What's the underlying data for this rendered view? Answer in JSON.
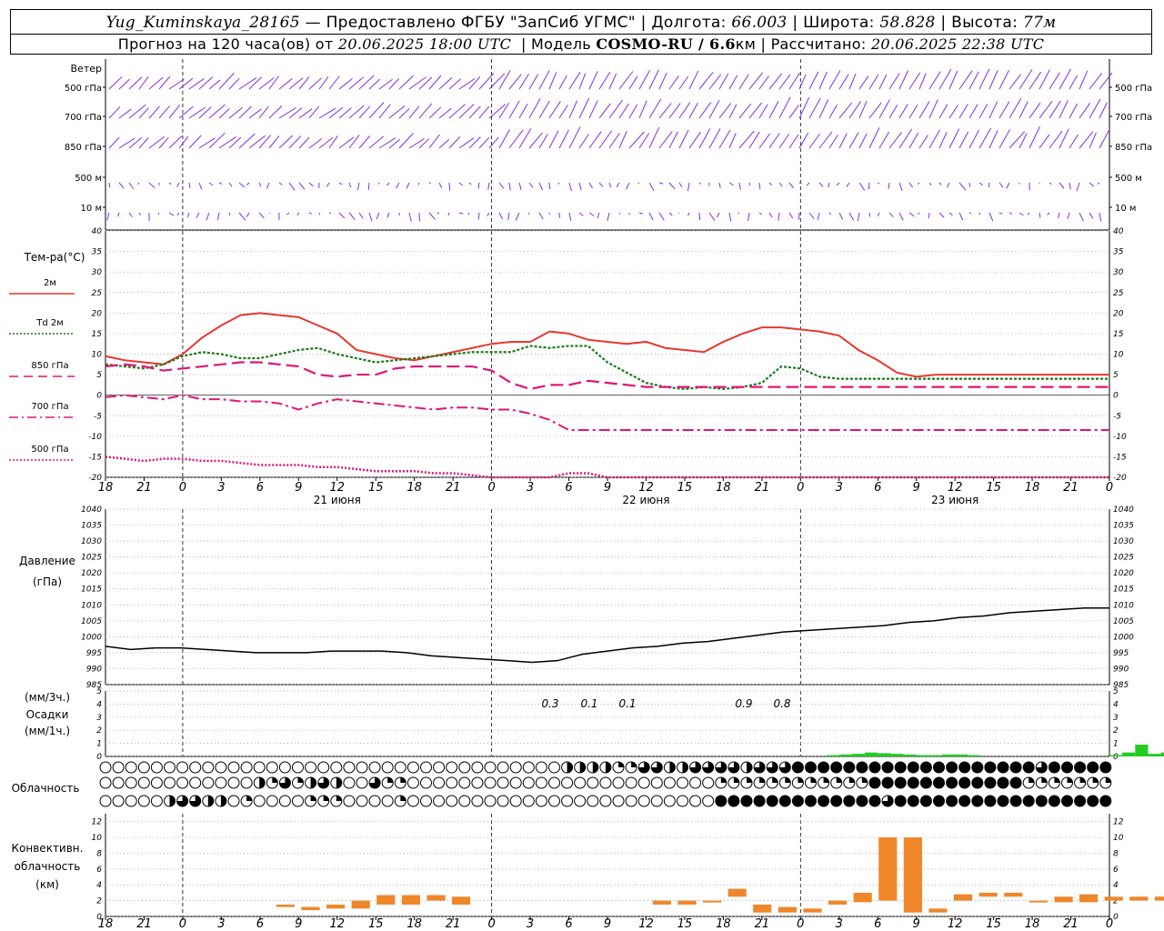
{
  "header": {
    "station": "Yug_Kuminskaya_28165",
    "provider": "— Предоставлено ФГБУ \"ЗапСиб УГМС\"",
    "lon_label": "Долгота:",
    "lon": "66.003",
    "lat_label": "Широта:",
    "lat": "58.828",
    "alt_label": "Высота:",
    "alt": "77м",
    "forecast_prefix": "Прогноз на 120 часа(ов) от",
    "forecast_time": "20.06.2025 18:00 UTC",
    "model_label": "Модель",
    "model": "COSMO-RU / 6.6",
    "model_unit": "км",
    "calc_label": "Рассчитано:",
    "calc_time": "20.06.2025 22:38 UTC"
  },
  "colors": {
    "t2m": "#e8372f",
    "td": "#1a7a1a",
    "t850": "#e0157a",
    "t700": "#e0157a",
    "t500": "#e0157a",
    "wind": "#8a2be2",
    "precip": "#22cc22",
    "conv": "#f0862a"
  },
  "wind_panel": {
    "title": "Ветер",
    "levels": [
      "500 гПа",
      "700 гПа",
      "850 гПа",
      "500  м",
      "10  м"
    ]
  },
  "temp_panel": {
    "title": "Тем-ра(°C)",
    "legend": [
      {
        "label": "2м",
        "style": "solid",
        "color": "#e8372f"
      },
      {
        "label": "2м",
        "prefix": "Td",
        "style": "dot",
        "color": "#1a7a1a"
      },
      {
        "label": "850 гПа",
        "style": "dash",
        "color": "#e0157a"
      },
      {
        "label": "700 гПа",
        "style": "dashdot",
        "color": "#e0157a"
      },
      {
        "label": "500 гПа",
        "style": "dot",
        "color": "#e0157a"
      }
    ]
  },
  "pressure_panel": {
    "title1": "Давление",
    "title2": "(гПа)"
  },
  "precip_panel": {
    "title1": "(мм/3ч.)",
    "title2": "Осадки",
    "title3": "(мм/1ч.)",
    "labels": [
      "0.3",
      "0.1",
      "0.1",
      "0.9",
      "0.8"
    ]
  },
  "cloud_panel": {
    "title": "Облачность"
  },
  "conv_panel": {
    "title1": "Конвективн.",
    "title2": "облачность",
    "title3": "(км)"
  },
  "time_axis": {
    "ticks": [
      "18",
      "21",
      "0",
      "3",
      "6",
      "9",
      "12",
      "15",
      "18",
      "21",
      "0",
      "3",
      "6",
      "9",
      "12",
      "15",
      "18",
      "21",
      "0",
      "3",
      "6",
      "9",
      "12",
      "15",
      "18",
      "21",
      "0"
    ],
    "dates": [
      "21 июня",
      "22 июня",
      "23 июня"
    ]
  },
  "chart_data": [
    {
      "type": "line",
      "title": "Тем-ра(°C)",
      "x_hours": [
        0,
        3,
        6,
        9,
        12,
        15,
        18,
        21,
        24,
        27,
        30,
        33,
        36,
        39,
        42,
        45,
        48,
        51,
        54,
        57,
        60,
        63,
        66,
        69,
        72,
        75,
        78,
        81,
        84,
        87,
        90,
        93,
        96,
        99,
        102,
        105,
        108,
        111,
        114,
        117,
        120,
        123,
        126,
        129,
        132,
        135,
        138,
        141,
        144,
        147,
        150,
        153,
        156
      ],
      "ylim": [
        -20,
        40
      ],
      "series": [
        {
          "name": "2м",
          "values": [
            9.5,
            8.5,
            8,
            7.5,
            10,
            14,
            17,
            19.5,
            20,
            19.5,
            19,
            17,
            15,
            11,
            10,
            9,
            8.5,
            9.5,
            10.5,
            11.5,
            12.5,
            13,
            13,
            15.5,
            15,
            13.5,
            13,
            12.5,
            13,
            11.5,
            11,
            10.5,
            13,
            15,
            16.5,
            16.5,
            16,
            15.5,
            14.5,
            11,
            8.5,
            5.5,
            4.5,
            5,
            5,
            5,
            5,
            5,
            5,
            5,
            5,
            5,
            5
          ]
        },
        {
          "name": "Td 2м",
          "values": [
            7.5,
            7,
            6.5,
            7.5,
            9.5,
            10.5,
            10,
            9,
            9,
            10,
            11,
            11.5,
            10,
            9,
            8,
            8.5,
            9,
            9.5,
            10,
            10.5,
            10.5,
            10.5,
            12,
            11.5,
            12,
            12,
            8,
            5.5,
            3,
            2,
            1.5,
            2,
            1.5,
            2,
            3,
            7,
            6.5,
            4.5,
            4,
            4,
            4,
            4,
            4,
            4,
            4,
            4,
            4,
            4,
            4,
            4,
            4,
            4,
            4
          ]
        },
        {
          "name": "850 гПа",
          "values": [
            7,
            7.5,
            7,
            6,
            6.5,
            7,
            7.5,
            8,
            8,
            7.5,
            7,
            5,
            4.5,
            5,
            5,
            6.5,
            7,
            7,
            7,
            7,
            6,
            3,
            1.5,
            2.5,
            2.5,
            3.5,
            3,
            2.5,
            2,
            2,
            2,
            2,
            2,
            2,
            2,
            2,
            2,
            2,
            2,
            2,
            2,
            2,
            2,
            2,
            2,
            2,
            2,
            2,
            2,
            2,
            2,
            2,
            2
          ]
        },
        {
          "name": "700 гПа",
          "values": [
            -0.5,
            0,
            -0.5,
            -1,
            0,
            -1,
            -1,
            -1.5,
            -1.5,
            -2,
            -3.5,
            -2,
            -1,
            -1.5,
            -2,
            -2.5,
            -3,
            -3.5,
            -3,
            -3,
            -3.5,
            -3.5,
            -4.5,
            -6,
            -8.5,
            -8.5,
            -8.5,
            -8.5,
            -8.5,
            -8.5,
            -8.5,
            -8.5,
            -8.5,
            -8.5,
            -8.5,
            -8.5,
            -8.5,
            -8.5,
            -8.5,
            -8.5,
            -8.5,
            -8.5,
            -8.5,
            -8.5,
            -8.5,
            -8.5,
            -8.5,
            -8.5,
            -8.5,
            -8.5,
            -8.5,
            -8.5,
            -8.5
          ]
        },
        {
          "name": "500 гПа",
          "values": [
            -15,
            -15.5,
            -16,
            -15.5,
            -15.5,
            -16,
            -16,
            -16.5,
            -17,
            -17,
            -17,
            -17.5,
            -17.5,
            -18,
            -18.5,
            -18.5,
            -18.5,
            -19,
            -19,
            -19.5,
            -20,
            -21,
            -21,
            -20,
            -19,
            -19,
            -20,
            -20,
            -20,
            -20,
            -20,
            -20,
            -20,
            -20,
            -20,
            -20,
            -20,
            -20,
            -20,
            -20,
            -20,
            -20,
            -20,
            -20,
            -20,
            -20,
            -20,
            -20,
            -20,
            -20,
            -20,
            -20,
            -20
          ]
        }
      ]
    },
    {
      "type": "line",
      "title": "Давление",
      "ylim": [
        985,
        1040
      ],
      "x_hours": [
        0,
        3,
        6,
        9,
        12,
        15,
        18,
        21,
        24,
        27,
        30,
        33,
        36,
        39,
        42,
        45,
        48,
        51,
        54,
        57,
        60,
        63,
        66,
        69,
        72,
        75,
        78,
        81,
        84,
        87,
        90,
        93,
        96,
        99,
        102,
        105,
        108,
        111,
        114,
        117,
        120
      ],
      "series": [
        {
          "name": "",
          "values": [
            997,
            996,
            996.5,
            996.5,
            996,
            995.5,
            995,
            995,
            995,
            995.5,
            995.5,
            995.5,
            995,
            994,
            993.5,
            993,
            992.5,
            992,
            992.5,
            994.5,
            995.5,
            996.5,
            997,
            998,
            998.5,
            999.5,
            1000.5,
            1001.5,
            1002,
            1002.5,
            1003,
            1003.5,
            1004.5,
            1005,
            1006,
            1006.5,
            1007.5,
            1008,
            1008.5,
            1009,
            1009
          ]
        }
      ]
    },
    {
      "type": "bar",
      "title": "Осадки",
      "ylim": [
        0,
        5
      ],
      "bars": [
        {
          "x": 57,
          "v": 0.1
        },
        {
          "x": 58,
          "v": 0.15
        },
        {
          "x": 59,
          "v": 0.2
        },
        {
          "x": 60,
          "v": 0.3
        },
        {
          "x": 61,
          "v": 0.25
        },
        {
          "x": 62,
          "v": 0.2
        },
        {
          "x": 63,
          "v": 0.15
        },
        {
          "x": 64,
          "v": 0.1
        },
        {
          "x": 65,
          "v": 0.1
        },
        {
          "x": 66,
          "v": 0.15
        },
        {
          "x": 67,
          "v": 0.15
        },
        {
          "x": 68,
          "v": 0.1
        },
        {
          "x": 79,
          "v": 0.1
        },
        {
          "x": 80,
          "v": 0.3
        },
        {
          "x": 81,
          "v": 0.9
        },
        {
          "x": 82,
          "v": 0.2
        },
        {
          "x": 83,
          "v": 0.3
        },
        {
          "x": 84,
          "v": 0.6
        }
      ]
    },
    {
      "type": "bar",
      "title": "Конвективн. облачность",
      "ylim": [
        0,
        13
      ],
      "bars": [
        {
          "x": 9,
          "b": 1.2,
          "t": 1.5
        },
        {
          "x": 12,
          "b": 0.8,
          "t": 1.2
        },
        {
          "x": 15,
          "b": 1,
          "t": 1.5
        },
        {
          "x": 18,
          "b": 1,
          "t": 2
        },
        {
          "x": 21,
          "b": 1.5,
          "t": 2.7
        },
        {
          "x": 24,
          "b": 1.5,
          "t": 2.7
        },
        {
          "x": 27,
          "b": 2,
          "t": 2.7
        },
        {
          "x": 30,
          "b": 1.5,
          "t": 2.5
        },
        {
          "x": 54,
          "b": 1.5,
          "t": 2
        },
        {
          "x": 57,
          "b": 1.5,
          "t": 2
        },
        {
          "x": 60,
          "b": 1.8,
          "t": 2
        },
        {
          "x": 63,
          "b": 2.5,
          "t": 3.5
        },
        {
          "x": 66,
          "b": 0.5,
          "t": 1.5
        },
        {
          "x": 69,
          "b": 0.5,
          "t": 1.2
        },
        {
          "x": 72,
          "b": 0.5,
          "t": 1
        },
        {
          "x": 75,
          "b": 1.5,
          "t": 2
        },
        {
          "x": 78,
          "b": 1.8,
          "t": 3
        },
        {
          "x": 81,
          "b": 2,
          "t": 10
        },
        {
          "x": 84,
          "b": 0.5,
          "t": 10
        },
        {
          "x": 87,
          "b": 0.5,
          "t": 1
        },
        {
          "x": 90,
          "b": 2,
          "t": 2.8
        },
        {
          "x": 93,
          "b": 2.5,
          "t": 3
        },
        {
          "x": 96,
          "b": 2.5,
          "t": 3
        },
        {
          "x": 99,
          "b": 1.8,
          "t": 2
        },
        {
          "x": 102,
          "b": 1.8,
          "t": 2.5
        },
        {
          "x": 105,
          "b": 1.8,
          "t": 2.8
        },
        {
          "x": 108,
          "b": 2,
          "t": 2.5
        },
        {
          "x": 111,
          "b": 2,
          "t": 2.5
        },
        {
          "x": 114,
          "b": 2,
          "t": 2.5
        },
        {
          "x": 117,
          "b": 2,
          "t": 2.8
        },
        {
          "x": 120,
          "b": 2.5,
          "t": 3
        }
      ]
    }
  ]
}
